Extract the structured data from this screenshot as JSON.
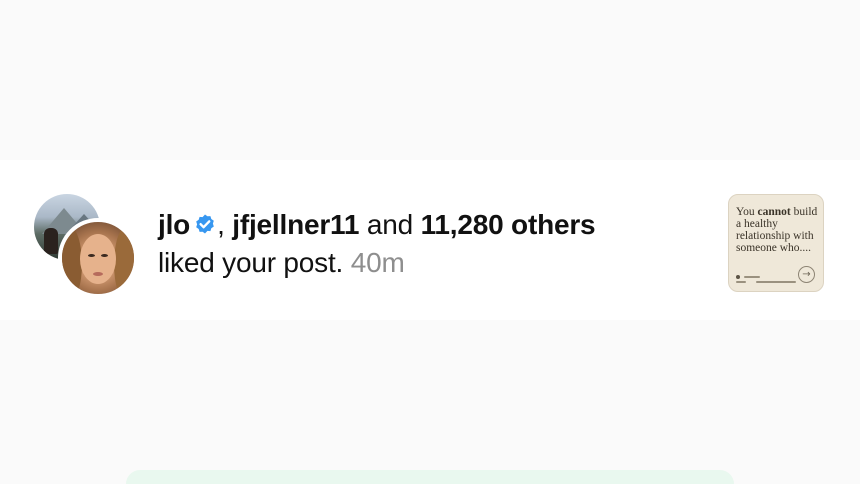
{
  "notification": {
    "user1": "jlo",
    "user2": "jfjellner11",
    "separator": ",",
    "conjunction": "and",
    "others": "11,280 others",
    "action": "liked your post.",
    "time": "40m"
  },
  "post_thumbnail": {
    "line_prefix": "You",
    "bold_word": "cannot",
    "line_rest": "build a healthy relationship with someone who...."
  },
  "colors": {
    "verified": "#3797f0",
    "time": "#8e8e8e",
    "bottom_pill": "#e9f8ef"
  },
  "icons": {
    "verified": "verified-badge-icon",
    "arrow": "arrow-right-icon"
  }
}
